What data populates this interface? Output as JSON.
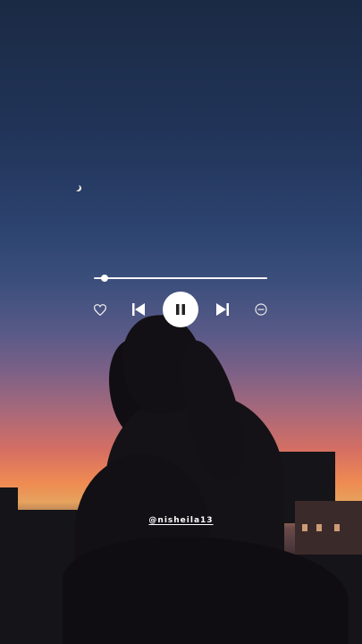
{
  "player": {
    "progress": 0.06,
    "controls": {
      "like": "heart-icon",
      "previous": "skip-previous-icon",
      "play_pause": "pause-icon",
      "next": "skip-next-icon",
      "block": "minus-circle-icon"
    },
    "accent_color": "#ffffff"
  },
  "credit": {
    "handle": "@nisheila13"
  }
}
